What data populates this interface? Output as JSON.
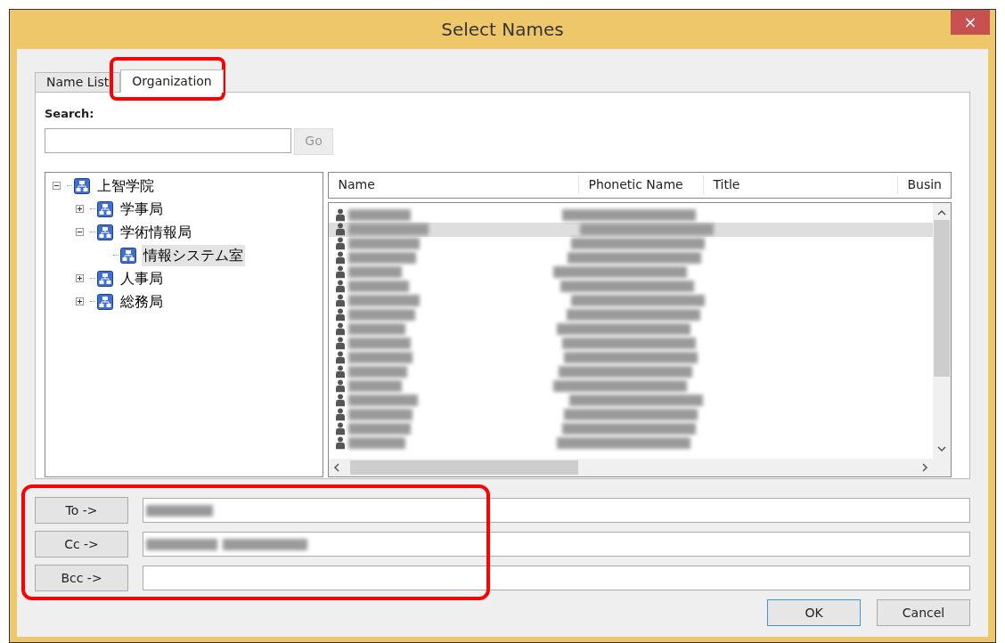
{
  "window": {
    "title": "Select Names",
    "close": "×"
  },
  "tabs": [
    {
      "label": "Name List",
      "selected": false
    },
    {
      "label": "Organization",
      "selected": true
    }
  ],
  "search": {
    "label": "Search:",
    "go": "Go"
  },
  "tree": [
    {
      "label": "上智学院",
      "expanded": true,
      "selected": false,
      "children": [
        {
          "label": "学事局",
          "expanded": false,
          "selected": false
        },
        {
          "label": "学術情報局",
          "expanded": true,
          "selected": false,
          "children": [
            {
              "label": "情報システム室",
              "selected": true
            }
          ]
        },
        {
          "label": "人事局",
          "expanded": false,
          "selected": false
        },
        {
          "label": "総務局",
          "expanded": false,
          "selected": false
        }
      ]
    }
  ],
  "table": {
    "columns": [
      "Name",
      "Phonetic Name",
      "Title",
      "Busin"
    ],
    "rows": [
      {
        "selected": false
      },
      {
        "selected": true
      },
      {
        "selected": false
      },
      {
        "selected": false
      },
      {
        "selected": false
      },
      {
        "selected": false
      },
      {
        "selected": false
      },
      {
        "selected": false
      },
      {
        "selected": false
      },
      {
        "selected": false
      },
      {
        "selected": false
      },
      {
        "selected": false
      },
      {
        "selected": false
      },
      {
        "selected": false
      },
      {
        "selected": false
      },
      {
        "selected": false
      },
      {
        "selected": false
      }
    ]
  },
  "recipients": [
    {
      "label": "To ->",
      "filled": true
    },
    {
      "label": "Cc ->",
      "filled": true
    },
    {
      "label": "Bcc ->",
      "filled": false
    }
  ],
  "buttons": [
    {
      "label": "OK",
      "default": true
    },
    {
      "label": "Cancel",
      "default": false
    }
  ]
}
